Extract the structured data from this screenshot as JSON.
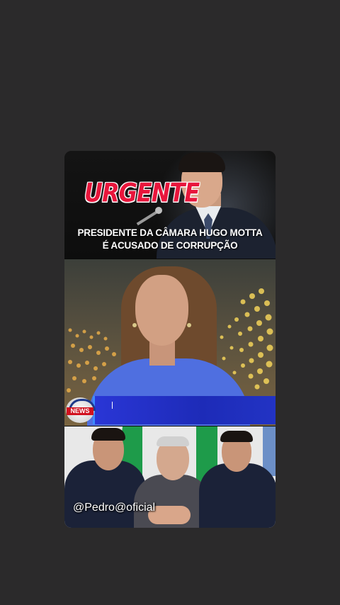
{
  "post": {
    "panel1": {
      "badge": "URGENTE",
      "headline_line1": "PRESIDENTE DA CÂMARA HUGO MOTTA",
      "headline_line2": "É ACUSADO DE CORRUPÇÃO"
    },
    "panel2": {
      "channel_logo_text": "NEWS"
    },
    "panel3": {
      "watermark": "@Pedro@oficial"
    }
  },
  "colors": {
    "page_bg": "#2b2a2b",
    "badge_red": "#e8163c",
    "lowerthird_blue": "#2a36d6",
    "news_red": "#d1121f"
  }
}
